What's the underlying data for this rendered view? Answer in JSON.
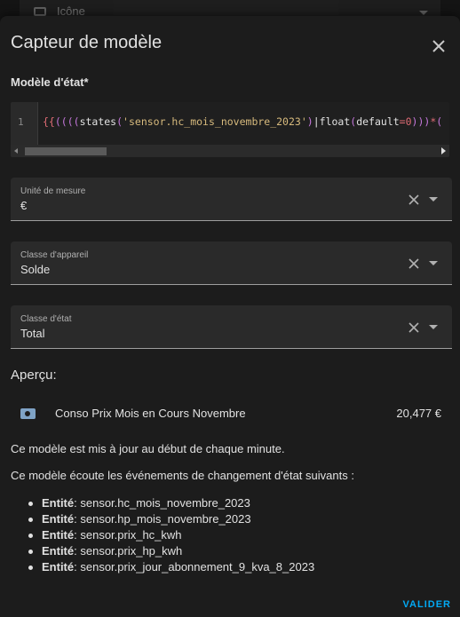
{
  "background": {
    "behind_label": "Icône"
  },
  "dialog": {
    "title": "Capteur de modèle",
    "close_icon": "close-icon"
  },
  "template": {
    "label": "Modèle d'état*",
    "line_number": "1",
    "code_tokens": [
      {
        "t": "{{",
        "c": "brace"
      },
      {
        "t": "((((",
        "c": "paren"
      },
      {
        "t": "states",
        "c": "func"
      },
      {
        "t": "(",
        "c": "paren"
      },
      {
        "t": "'sensor.hc_mois_novembre_2023'",
        "c": "str"
      },
      {
        "t": ")",
        "c": "paren"
      },
      {
        "t": "|",
        "c": "pipe"
      },
      {
        "t": "float",
        "c": "func"
      },
      {
        "t": "(",
        "c": "paren"
      },
      {
        "t": "default",
        "c": "func"
      },
      {
        "t": "=",
        "c": "op"
      },
      {
        "t": "0",
        "c": "num"
      },
      {
        "t": ")))",
        "c": "paren"
      },
      {
        "t": "*",
        "c": "op"
      },
      {
        "t": "(",
        "c": "paren"
      }
    ]
  },
  "fields": [
    {
      "label": "Unité de mesure",
      "value": "€"
    },
    {
      "label": "Classe d'appareil",
      "value": "Solde"
    },
    {
      "label": "Classe d'état",
      "value": "Total"
    }
  ],
  "preview": {
    "title": "Aperçu:",
    "entity_icon": "cash-icon",
    "entity_name": "Conso Prix Mois en Cours Novembre",
    "entity_state": "20,477 €",
    "update_text": "Ce modèle est mis à jour au début de chaque minute.",
    "listen_text": "Ce modèle écoute les événements de changement d'état suivants :",
    "entity_prefix": "Entité",
    "listeners": [
      "sensor.hc_mois_novembre_2023",
      "sensor.hp_mois_novembre_2023",
      "sensor.prix_hc_kwh",
      "sensor.prix_hp_kwh",
      "sensor.prix_jour_abonnement_9_kva_8_2023"
    ]
  },
  "actions": {
    "submit_label": "VALIDER"
  },
  "colors": {
    "accent": "#03a9f4",
    "surface": "#1c1c1c",
    "field_bg": "#2a2a2a"
  }
}
